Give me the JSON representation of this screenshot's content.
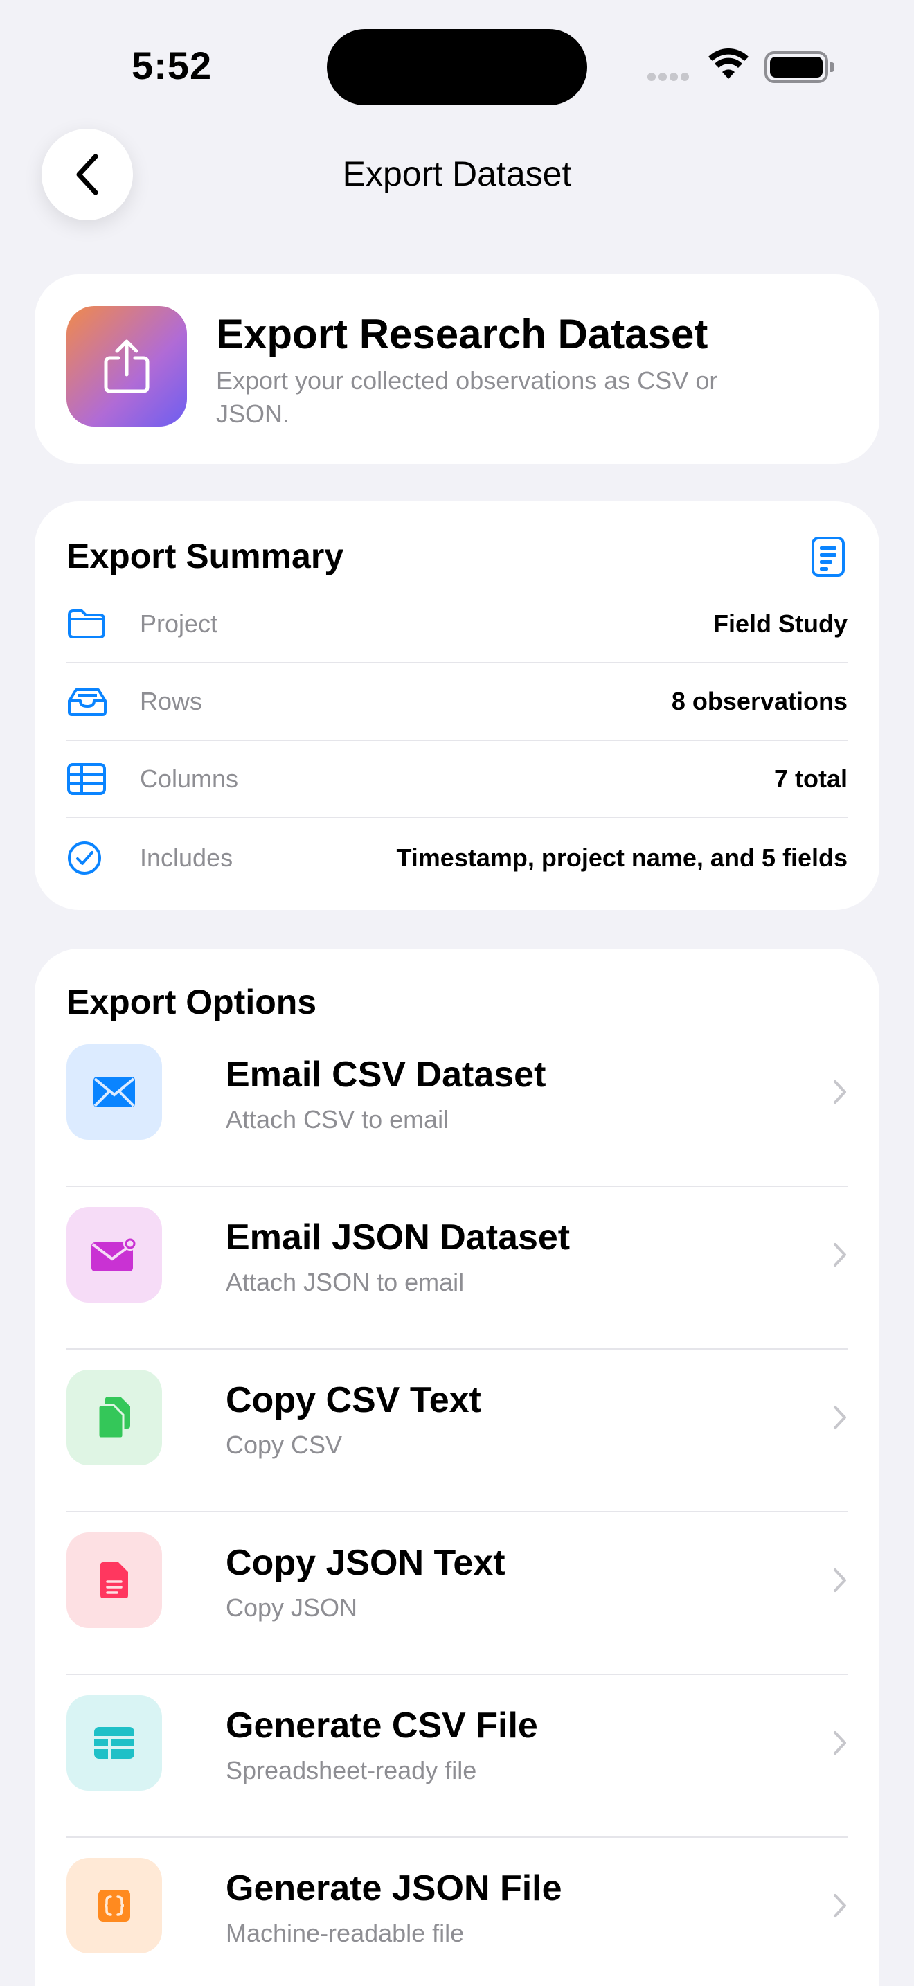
{
  "status": {
    "time": "5:52"
  },
  "nav": {
    "title": "Export Dataset"
  },
  "header": {
    "title": "Export Research Dataset",
    "subtitle": "Export your collected observations as CSV or JSON."
  },
  "summary": {
    "title": "Export Summary",
    "rows": [
      {
        "icon": "folder-icon",
        "label": "Project",
        "value": "Field Study"
      },
      {
        "icon": "tray-icon",
        "label": "Rows",
        "value": "8 observations"
      },
      {
        "icon": "table-icon",
        "label": "Columns",
        "value": "7 total"
      },
      {
        "icon": "checkmark-circle-icon",
        "label": "Includes",
        "value": "Timestamp, project name, and 5 fields"
      }
    ]
  },
  "options": {
    "title": "Export Options",
    "items": [
      {
        "icon": "envelope-icon",
        "name": "Email CSV Dataset",
        "desc": "Attach CSV to email",
        "tint": "#dcebff",
        "color": "#0a84ff"
      },
      {
        "icon": "envelope-badge-icon",
        "name": "Email JSON Dataset",
        "desc": "Attach JSON to email",
        "tint": "#f6dcf7",
        "color": "#c932d3"
      },
      {
        "icon": "copy-documents-icon",
        "name": "Copy CSV Text",
        "desc": "Copy CSV",
        "tint": "#dff5e4",
        "color": "#34c759"
      },
      {
        "icon": "document-text-icon",
        "name": "Copy JSON Text",
        "desc": "Copy JSON",
        "tint": "#fde0e3",
        "color": "#ff375f"
      },
      {
        "icon": "table-icon",
        "name": "Generate CSV File",
        "desc": "Spreadsheet-ready file",
        "tint": "#d9f4f4",
        "color": "#1fc0c7"
      },
      {
        "icon": "curly-braces-icon",
        "name": "Generate JSON File",
        "desc": "Machine-readable file",
        "tint": "#ffe9d6",
        "color": "#ff8a1f"
      }
    ]
  }
}
